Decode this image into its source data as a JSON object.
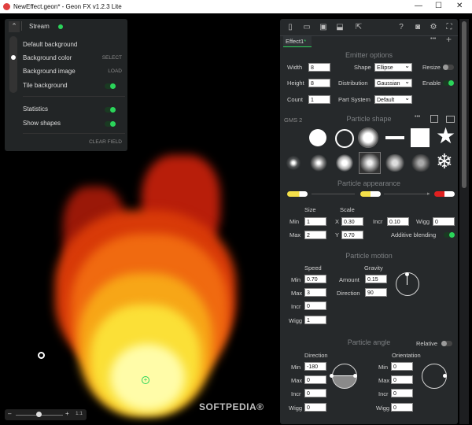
{
  "window": {
    "title": "NewEffect.geon* - Geon FX v1.2.3 Lite",
    "minimize": "—",
    "maximize": "☐",
    "close": "✕"
  },
  "overlay": {
    "stream_label": "Stream",
    "default_background": "Default background",
    "background_color": "Background color",
    "select": "SELECT",
    "background_image": "Background image",
    "load": "LOAD",
    "tile_background": "Tile background",
    "statistics": "Statistics",
    "show_shapes": "Show shapes",
    "clear_field": "CLEAR FIELD"
  },
  "viewport": {
    "zoom_minus": "–",
    "zoom_plus": "+",
    "zoom_ratio": "1:1",
    "watermark": "SOFTPEDIA®"
  },
  "tabs": {
    "effect1": "Effect1",
    "more": "•••",
    "add": "+"
  },
  "emitter": {
    "section": "Emitter options",
    "width_label": "Width",
    "width": "8",
    "height_label": "Height",
    "height": "8",
    "count_label": "Count",
    "count": "1",
    "shape_label": "Shape",
    "shape": "Ellipse",
    "distribution_label": "Distribution",
    "distribution": "Gaussian",
    "part_system_label": "Part System",
    "part_system": "Default",
    "resize_label": "Resize",
    "enable_label": "Enable"
  },
  "shape": {
    "section": "Particle shape",
    "gms": "GMS 2",
    "more": "•••"
  },
  "appearance": {
    "section": "Particle appearance",
    "size_label": "Size",
    "scale_label": "Scale",
    "min_label": "Min",
    "max_label": "Max",
    "size_min": "1",
    "size_max": "2",
    "x_label": "X",
    "y_label": "Y",
    "scale_x": "0.30",
    "scale_y": "0.70",
    "incr_label": "Incr",
    "incr": "0.10",
    "wigg_label": "Wigg",
    "wigg": "0",
    "additive_label": "Additive blending"
  },
  "motion": {
    "section": "Particle motion",
    "speed_label": "Speed",
    "gravity_label": "Gravity",
    "min_label": "Min",
    "max_label": "Max",
    "incr_label": "Incr",
    "wigg_label": "Wigg",
    "speed_min": "0.70",
    "speed_max": "3",
    "speed_incr": "0",
    "speed_wigg": "1",
    "amount_label": "Amount",
    "amount": "0.15",
    "direction_label": "Direction",
    "direction": "90"
  },
  "angle": {
    "section": "Particle angle",
    "relative_label": "Relative",
    "direction_label": "Direction",
    "orientation_label": "Orientation",
    "min_label": "Min",
    "max_label": "Max",
    "incr_label": "Incr",
    "wigg_label": "Wigg",
    "dir_min": "-180",
    "dir_max": "0",
    "dir_incr": "0",
    "dir_wigg": "0",
    "ori_min": "0",
    "ori_max": "0",
    "ori_incr": "0",
    "ori_wigg": "0"
  },
  "colors": {
    "accent": "#2bd45a",
    "panel": "#26292b",
    "c1": "#f4e04a",
    "c2": "#e6c84a",
    "c3": "#e02020"
  }
}
